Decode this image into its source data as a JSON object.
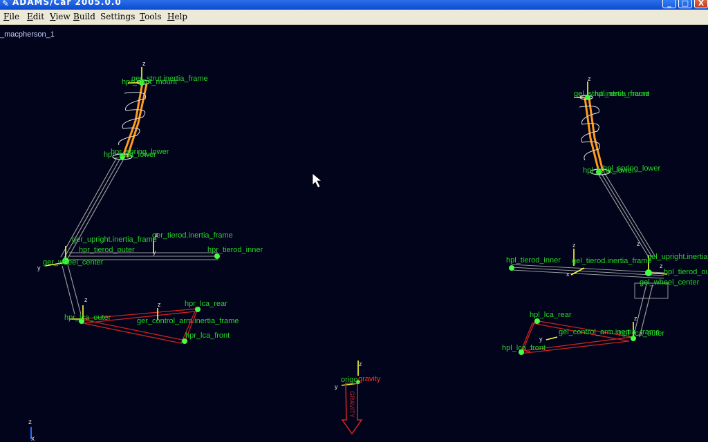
{
  "window": {
    "title": "ADAMS/Car 2005.0.0",
    "minimize": "_",
    "maximize": "□",
    "close": "X"
  },
  "menu": [
    {
      "hot": "F",
      "rest": "ile"
    },
    {
      "hot": "E",
      "rest": "dit"
    },
    {
      "hot": "V",
      "rest": "iew"
    },
    {
      "hot": "B",
      "rest": "uild"
    },
    {
      "hot": "",
      "rest": "Settings"
    },
    {
      "hot": "T",
      "rest": "ools"
    },
    {
      "hot": "H",
      "rest": "elp"
    }
  ],
  "viewport": {
    "model_name": "_macpherson_1",
    "triad": {
      "z": "z",
      "x": "x"
    },
    "colors": {
      "background": "#01041a",
      "label": "#26d626",
      "axis": "#ffff33",
      "link": "#a0a0a0",
      "spring": "#ff9a1a",
      "control_arm": "#cc2222",
      "gravity": "#cc2222"
    }
  },
  "labels": {
    "right_side": {
      "strut_mount": "hpr_strut_mount",
      "strut_inertia": "ger_strut.inertia_frame",
      "spring_lower": "hpr_spring_lower",
      "strut_lower": "hpr_strut_lower",
      "upright_inertia": "ger_upright.inertia_frame",
      "tierod_inertia": "ger_tierod.inertia_frame",
      "tierod_outer": "hpr_tierod_outer",
      "tierod_inner": "hpr_tierod_inner",
      "wheel_center": "ger_wheel_center",
      "lca_outer": "hpr_lca_outer",
      "lca_rear": "hpr_lca_rear",
      "control_arm_inertia": "ger_control_arm.inertia_frame",
      "lca_front": "hpr_lca_front"
    },
    "left_side": {
      "strut_inertia": "gel_strut.inertia_frame",
      "strut_mount": "hpl_strut_mount",
      "strut_lower": "hpl_strut_lower",
      "spring_lower": "hpl_spring_lower",
      "tierod_inner": "hpl_tierod_inner",
      "tierod_inertia": "gel_tierod.inertia_frame",
      "upright_inertia": "gel_upright.inertia_frame",
      "tierod_outer": "hpl_tierod_outer",
      "wheel_center": "gel_wheel_center",
      "lca_rear": "hpl_lca_rear",
      "control_arm_inertia": "gel_control_arm.inertia_frame",
      "lca_outer": "hpl_lca_outer",
      "lca_front": "hpl_lca_front"
    },
    "origin": "origo",
    "gravity": "gravity",
    "gravity_arrow": "GRAVITY"
  },
  "axis_letters": {
    "z": "z",
    "y": "y",
    "x": "x"
  }
}
